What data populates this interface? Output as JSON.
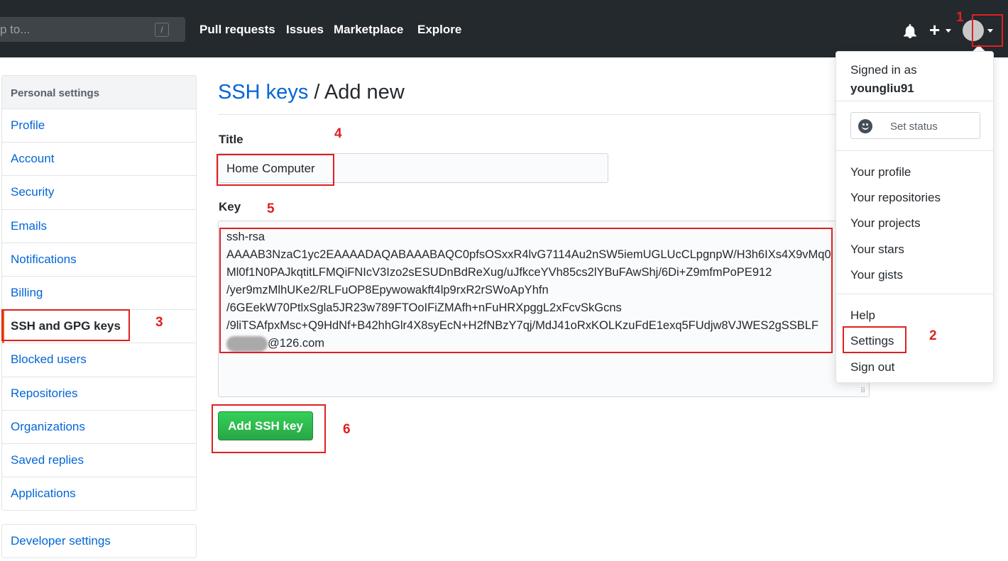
{
  "header": {
    "search_placeholder": "p to...",
    "search_shortcut": "/",
    "nav": [
      "Pull requests",
      "Issues",
      "Marketplace",
      "Explore"
    ],
    "plus_label": "+"
  },
  "annotations": [
    "1",
    "2",
    "3",
    "4",
    "5",
    "6"
  ],
  "sidebar": {
    "heading": "Personal settings",
    "items": [
      {
        "label": "Profile"
      },
      {
        "label": "Account"
      },
      {
        "label": "Security"
      },
      {
        "label": "Emails"
      },
      {
        "label": "Notifications"
      },
      {
        "label": "Billing"
      },
      {
        "label": "SSH and GPG keys",
        "active": true
      },
      {
        "label": "Blocked users"
      },
      {
        "label": "Repositories"
      },
      {
        "label": "Organizations"
      },
      {
        "label": "Saved replies"
      },
      {
        "label": "Applications"
      }
    ],
    "developer": "Developer settings"
  },
  "main": {
    "title_link": "SSH keys",
    "title_rest": " / Add new",
    "title_label": "Title",
    "title_value": "Home Computer",
    "key_label": "Key",
    "key_lines": [
      "ssh-rsa",
      "AAAAB3NzaC1yc2EAAAADAQABAAABAQC0pfsOSxxR4lvG7114Au2nSW5iemUGLUcCLpgnpW/H3h6IXs4X9vMq0",
      "Ml0f1N0PAJkqtitLFMQiFNIcV3Izo2sESUDnBdReXug/uJfkceYVh85cs2lYBuFAwShj/6Di+Z9mfmPoPE912",
      "/yer9mzMlhUKe2/RLFuOP8Epywowakft4lp9rxR2rSWoApYhfn",
      "/6GEekW70PtlxSgla5JR23w789FTOoIFiZMAfh+nFuHRXpggL2xFcvSkGcns",
      "/9liTSAfpxMsc+Q9HdNf+B42hhGlr4X8syEcN+H2fNBzY7qj/MdJ41oRxKOLKzuFdE1exq5FUdjw8VJWES2gSSBLF"
    ],
    "key_email_suffix": "@126.com",
    "button": "Add SSH key"
  },
  "dropdown": {
    "signed_in": "Signed in as",
    "username": "youngliu91",
    "set_status": "Set status",
    "items_a": [
      "Your profile",
      "Your repositories",
      "Your projects",
      "Your stars",
      "Your gists"
    ],
    "help": "Help",
    "settings": "Settings",
    "sign_out": "Sign out"
  },
  "colors": {
    "accent": "#0366d6",
    "button": "#28a745",
    "annotation": "#e02020",
    "header": "#24292e"
  }
}
